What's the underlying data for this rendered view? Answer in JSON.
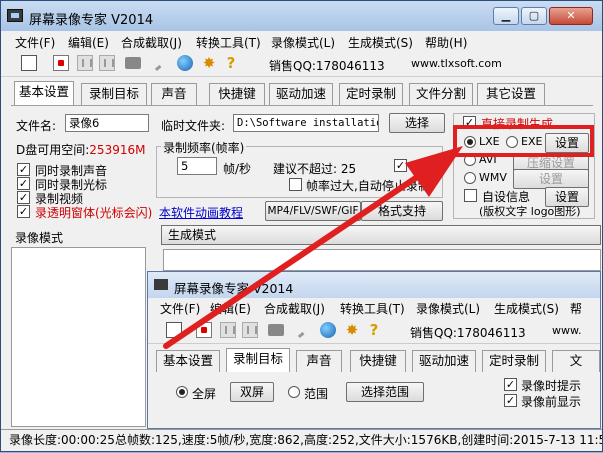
{
  "window": {
    "title": "屏幕录像专家 V2014"
  },
  "menu": [
    "文件(F)",
    "编辑(E)",
    "合成截取(J)",
    "转换工具(T)",
    "录像模式(L)",
    "生成模式(S)",
    "帮助(H)"
  ],
  "toolbar": {
    "qq": "销售QQ:178046113",
    "url": "www.tlxsoft.com"
  },
  "tabs": [
    "基本设置",
    "录制目标",
    "声音",
    "快捷键",
    "驱动加速",
    "定时录制",
    "文件分割",
    "其它设置"
  ],
  "form": {
    "filename_label": "文件名:",
    "filename_value": "录像6",
    "tempdir_label": "临时文件夹:",
    "tempdir_value": "D:\\Software installatio",
    "browse": "选择",
    "disk_label": "D盘可用空间:",
    "disk_value": "253916M",
    "opt_audio": "同时录制声音",
    "opt_cursor": "同时录制光标",
    "opt_video": "录制视频",
    "opt_transparent": "录透明窗体(光标会闪)",
    "tutorial": "本软件动画教程",
    "formats": "MP4/FLV/SWF/GIF",
    "format_btn": "格式支持"
  },
  "framerate": {
    "title": "录制频率(帧率)",
    "value": "5",
    "unit": "帧/秒",
    "advise": "建议不超过: 25",
    "auto": "自动",
    "autofit": "帧率过大,自动停止录制"
  },
  "right": {
    "direct": "直接录制生成",
    "lxe": "LXE",
    "exe": "EXE",
    "setup": "设置",
    "avi": "AVI",
    "compress": "压缩设置",
    "wmv": "WMV",
    "setup2": "设置",
    "custom": "自设信息",
    "setup3": "设置",
    "copyright": "(版权文字 logo图形)"
  },
  "modes": {
    "record_mode": "录像模式",
    "gen_mode": "生成模式"
  },
  "inner": {
    "title": "屏幕录像专家 V2014",
    "menu": [
      "文件(F)",
      "编辑(E)",
      "合成截取(J)",
      "转换工具(T)",
      "录像模式(L)",
      "生成模式(S)",
      "帮"
    ],
    "qq": "销售QQ:178046113",
    "url": "www.",
    "tabs": [
      "基本设置",
      "录制目标",
      "声音",
      "快捷键",
      "驱动加速",
      "定时录制",
      "文"
    ],
    "fullscreen": "全屏",
    "dual": "双屏",
    "range": "范围",
    "select_range": "选择范围",
    "rec_hint": "录像时提示",
    "rec_before": "录像前显示"
  },
  "status": "录像长度:00:00:25总帧数:125,速度:5帧/秒,宽度:862,高度:252,文件大小:1576KB,创建时间:2015-7-13 11:5",
  "colors": {
    "accent_red": "#e02020",
    "disk_red": "#d00000",
    "link_blue": "#0000cc"
  }
}
